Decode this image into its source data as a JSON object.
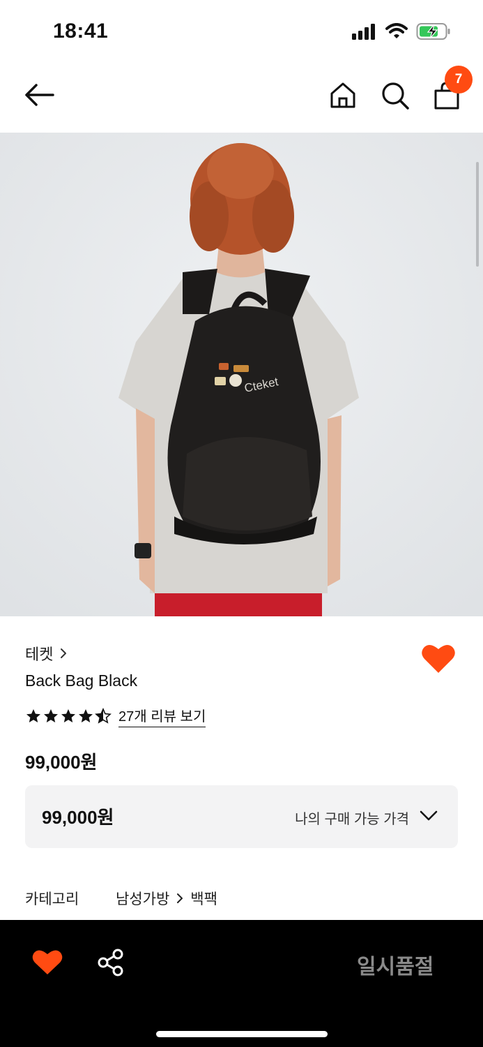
{
  "status_bar": {
    "time": "18:41"
  },
  "nav": {
    "cart_count": "7"
  },
  "product": {
    "brand": "테켓",
    "name": "Back Bag Black",
    "rating": 4.5,
    "rating_max": 5,
    "review_link": "27개 리뷰 보기",
    "price": "99,000원",
    "my_price": "99,000원",
    "my_price_label": "나의 구매 가능 가격",
    "image_text": "Cteket",
    "category_label": "카테고리",
    "category_path": [
      "남성가방",
      "백팩"
    ]
  },
  "bottom_bar": {
    "soldout_label": "일시품절"
  },
  "colors": {
    "accent": "#ff4b12",
    "bottom_bar": "#000000",
    "price_box": "#f3f3f4",
    "soldout_text": "#8a8a8a"
  }
}
